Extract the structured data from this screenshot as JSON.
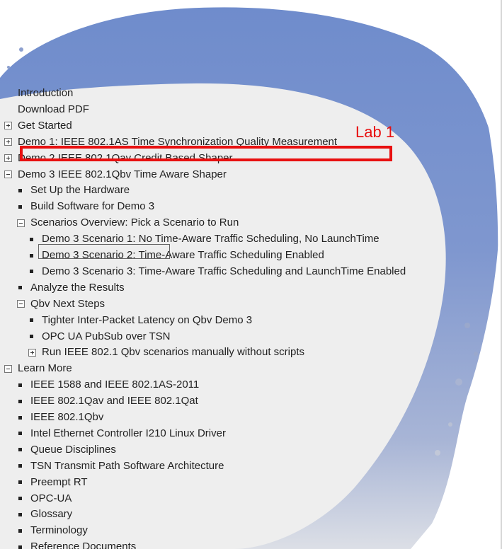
{
  "annotation": {
    "label": "Lab 1",
    "color": "#e81010"
  },
  "nav": {
    "items": [
      {
        "label": "Introduction",
        "marker": "none",
        "indent": 0
      },
      {
        "label": "Download PDF",
        "marker": "none",
        "indent": 0
      },
      {
        "label": "Get Started",
        "marker": "plus",
        "indent": 0
      },
      {
        "label": "Demo 1: IEEE 802.1AS Time Synchronization Quality Measurement",
        "marker": "plus",
        "indent": 0
      },
      {
        "label": "Demo 2 IEEE 802.1Qav Credit Based Shaper",
        "marker": "plus",
        "indent": 0
      },
      {
        "label": "Demo 3 IEEE 802.1Qbv Time Aware Shaper",
        "marker": "minus",
        "indent": 0
      },
      {
        "label": "Set Up the Hardware",
        "marker": "bullet",
        "indent": 1
      },
      {
        "label": "Build Software for Demo 3",
        "marker": "bullet",
        "indent": 1
      },
      {
        "label": "Scenarios Overview: Pick a Scenario to Run",
        "marker": "minus",
        "indent": 1
      },
      {
        "label": "Demo 3 Scenario 1: No Time-Aware Traffic Scheduling, No LaunchTime",
        "marker": "bullet",
        "indent": 2
      },
      {
        "label": "Demo 3 Scenario 2: Time-Aware Traffic Scheduling Enabled",
        "marker": "bullet",
        "indent": 2
      },
      {
        "label": "Demo 3 Scenario 3: Time-Aware Traffic Scheduling and LaunchTime Enabled",
        "marker": "bullet",
        "indent": 2
      },
      {
        "label": "Analyze the Results",
        "marker": "bullet",
        "indent": 1
      },
      {
        "label": "Qbv Next Steps",
        "marker": "minus",
        "indent": 1
      },
      {
        "label": "Tighter Inter-Packet Latency on Qbv Demo 3",
        "marker": "bullet",
        "indent": 2
      },
      {
        "label": "OPC UA PubSub over TSN",
        "marker": "bullet",
        "indent": 2
      },
      {
        "label": "Run IEEE 802.1 Qbv scenarios manually without scripts",
        "marker": "plus",
        "indent": 2
      },
      {
        "label": "Learn More",
        "marker": "minus",
        "indent": 0
      },
      {
        "label": "IEEE 1588 and IEEE 802.1AS-2011",
        "marker": "bullet",
        "indent": 1
      },
      {
        "label": "IEEE 802.1Qav and IEEE 802.1Qat",
        "marker": "bullet",
        "indent": 1
      },
      {
        "label": "IEEE 802.1Qbv",
        "marker": "bullet",
        "indent": 1
      },
      {
        "label": "Intel Ethernet Controller I210 Linux Driver",
        "marker": "bullet",
        "indent": 1
      },
      {
        "label": "Queue Disciplines",
        "marker": "bullet",
        "indent": 1
      },
      {
        "label": "TSN Transmit Path Software Architecture",
        "marker": "bullet",
        "indent": 1
      },
      {
        "label": "Preempt RT",
        "marker": "bullet",
        "indent": 1
      },
      {
        "label": "OPC-UA",
        "marker": "bullet",
        "indent": 1
      },
      {
        "label": "Glossary",
        "marker": "bullet",
        "indent": 1
      },
      {
        "label": "Terminology",
        "marker": "bullet",
        "indent": 1
      },
      {
        "label": "Reference Documents",
        "marker": "bullet",
        "indent": 1
      }
    ]
  },
  "colors": {
    "brush_blue": "#7f97cf",
    "panel_gray": "#eeeeee",
    "text": "#222222"
  }
}
